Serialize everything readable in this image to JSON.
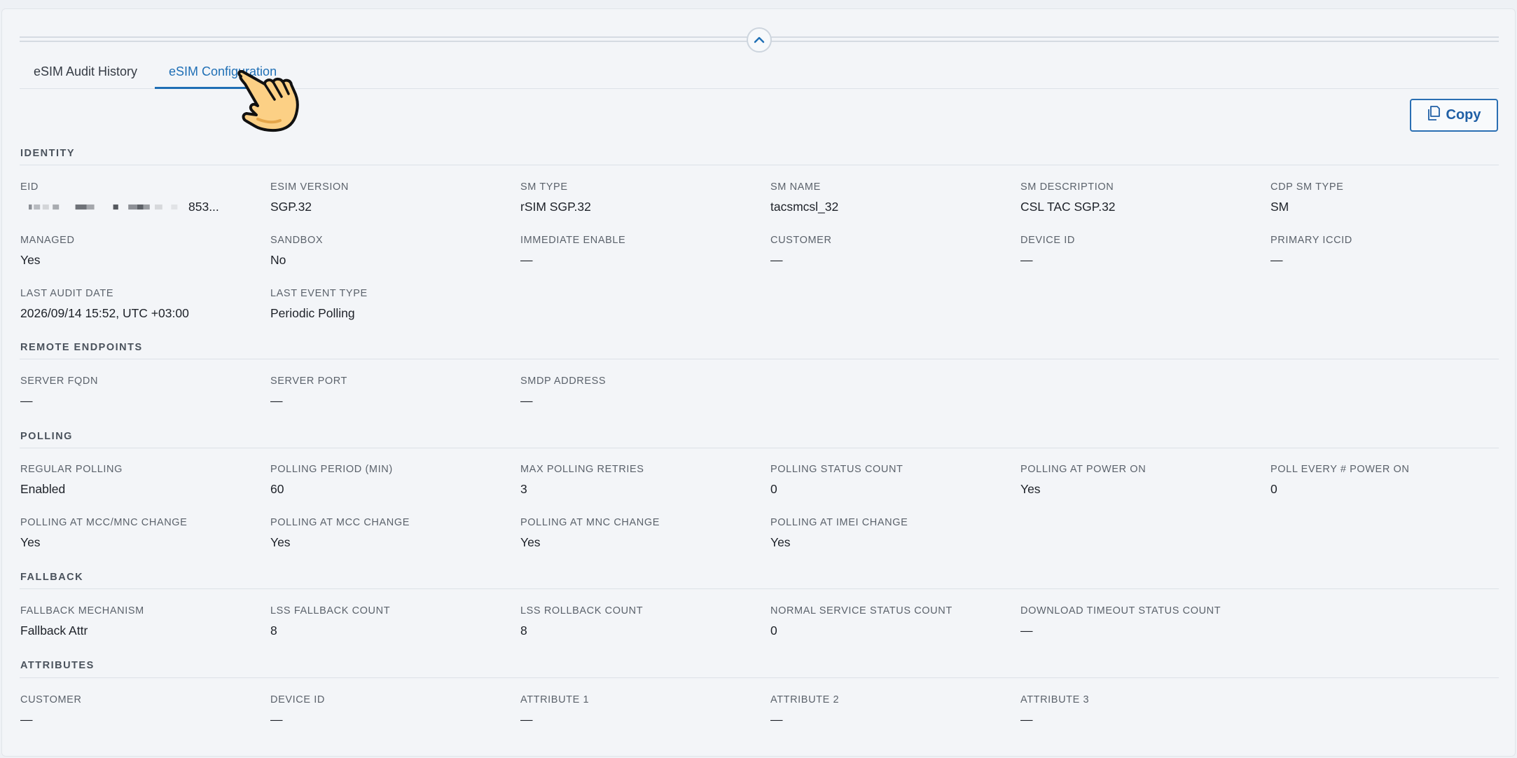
{
  "tabs": [
    {
      "label": "eSIM Audit History",
      "active": false
    },
    {
      "label": "eSIM Configuration",
      "active": true
    }
  ],
  "toolbar": {
    "copy_label": "Copy"
  },
  "colors": {
    "accent": "#1f6fb5",
    "text": "#1d2128",
    "label": "#5b626b"
  },
  "icons": {
    "collapse": "chevron-up-icon",
    "copy": "copy-icon",
    "cursor": "hand-pointer-icon"
  },
  "sections": {
    "identity": {
      "title": "IDENTITY",
      "fields": [
        {
          "label": "EID",
          "value": "853..."
        },
        {
          "label": "ESIM VERSION",
          "value": "SGP.32"
        },
        {
          "label": "SM TYPE",
          "value": "rSIM SGP.32"
        },
        {
          "label": "SM NAME",
          "value": "tacsmcsl_32"
        },
        {
          "label": "SM DESCRIPTION",
          "value": "CSL TAC SGP.32"
        },
        {
          "label": "CDP SM TYPE",
          "value": "SM"
        },
        {
          "label": "MANAGED",
          "value": "Yes"
        },
        {
          "label": "SANDBOX",
          "value": "No"
        },
        {
          "label": "IMMEDIATE ENABLE",
          "value": "—"
        },
        {
          "label": "CUSTOMER",
          "value": "—"
        },
        {
          "label": "DEVICE ID",
          "value": "—"
        },
        {
          "label": "PRIMARY ICCID",
          "value": "—"
        },
        {
          "label": "LAST AUDIT DATE",
          "value": "2026/09/14 15:52, UTC +03:00"
        },
        {
          "label": "LAST EVENT TYPE",
          "value": "Periodic Polling"
        }
      ]
    },
    "remote_endpoints": {
      "title": "REMOTE ENDPOINTS",
      "fields": [
        {
          "label": "SERVER FQDN",
          "value": "—"
        },
        {
          "label": "SERVER PORT",
          "value": "—"
        },
        {
          "label": "SMDP ADDRESS",
          "value": "—"
        }
      ]
    },
    "polling": {
      "title": "POLLING",
      "fields": [
        {
          "label": "REGULAR POLLING",
          "value": "Enabled"
        },
        {
          "label": "POLLING PERIOD (MIN)",
          "value": "60"
        },
        {
          "label": "MAX POLLING RETRIES",
          "value": "3"
        },
        {
          "label": "POLLING STATUS COUNT",
          "value": "0"
        },
        {
          "label": "POLLING AT POWER ON",
          "value": "Yes"
        },
        {
          "label": "POLL EVERY # POWER ON",
          "value": "0"
        },
        {
          "label": "POLLING AT MCC/MNC CHANGE",
          "value": "Yes"
        },
        {
          "label": "POLLING AT MCC CHANGE",
          "value": "Yes"
        },
        {
          "label": "POLLING AT MNC CHANGE",
          "value": "Yes"
        },
        {
          "label": "POLLING AT IMEI CHANGE",
          "value": "Yes"
        }
      ]
    },
    "fallback": {
      "title": "FALLBACK",
      "fields": [
        {
          "label": "FALLBACK MECHANISM",
          "value": "Fallback Attr"
        },
        {
          "label": "LSS FALLBACK COUNT",
          "value": "8"
        },
        {
          "label": "LSS ROLLBACK COUNT",
          "value": "8"
        },
        {
          "label": "NORMAL SERVICE STATUS COUNT",
          "value": "0"
        },
        {
          "label": "DOWNLOAD TIMEOUT STATUS COUNT",
          "value": "—"
        }
      ]
    },
    "attributes": {
      "title": "ATTRIBUTES",
      "fields": [
        {
          "label": "CUSTOMER",
          "value": "—"
        },
        {
          "label": "DEVICE ID",
          "value": "—"
        },
        {
          "label": "ATTRIBUTE 1",
          "value": "—"
        },
        {
          "label": "ATTRIBUTE 2",
          "value": "—"
        },
        {
          "label": "ATTRIBUTE 3",
          "value": "—"
        }
      ]
    }
  }
}
